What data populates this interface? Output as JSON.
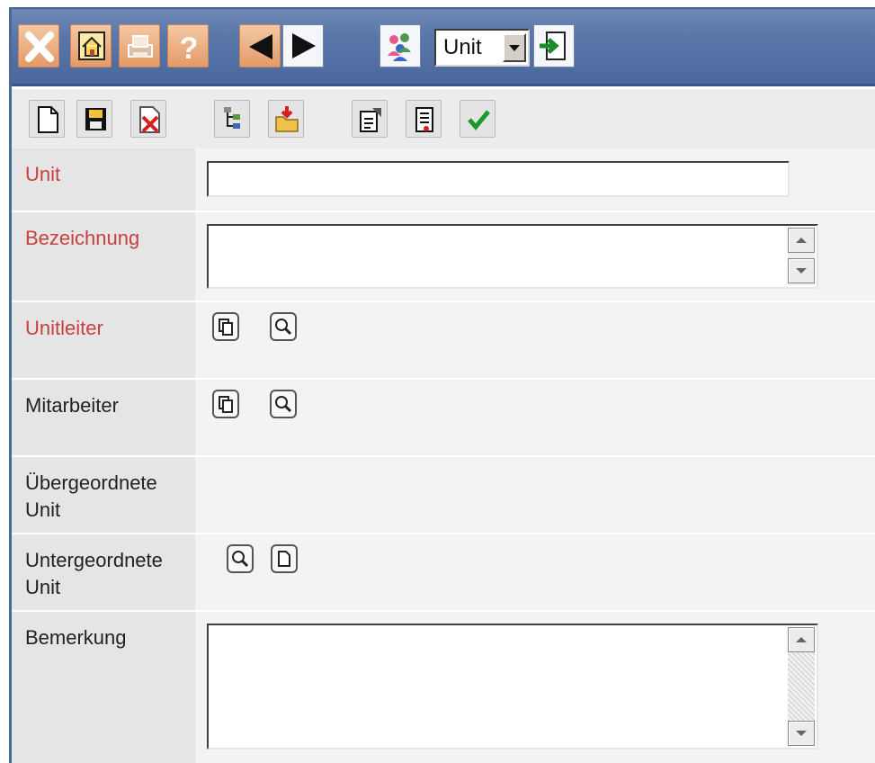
{
  "toolbar": {
    "close": "close-icon",
    "home": "home-icon",
    "print": "print-icon",
    "help": "help-icon",
    "back": "arrow-left-icon",
    "forward": "arrow-right-icon",
    "users": "users-icon",
    "entity_select": {
      "value": "Unit"
    },
    "go": "enter-icon"
  },
  "actions": [
    "new-document-icon",
    "save-icon",
    "delete-icon",
    "tree-icon",
    "open-folder-icon",
    "properties-icon",
    "report-icon",
    "check-icon"
  ],
  "form": {
    "unit": {
      "label": "Unit",
      "value": ""
    },
    "bezeichnung": {
      "label": "Bezeichnung",
      "value": ""
    },
    "unitleiter": {
      "label": "Unitleiter"
    },
    "mitarbeiter": {
      "label": "Mitarbeiter"
    },
    "uebergeordnete": {
      "label": "Übergeordnete Unit"
    },
    "untergeordnete": {
      "label": "Untergeordnete Unit"
    },
    "bemerkung": {
      "label": "Bemerkung",
      "value": ""
    }
  },
  "colors": {
    "required_label": "#c84040",
    "topbar": "#5876a8",
    "orange_button": "#e39b67"
  }
}
